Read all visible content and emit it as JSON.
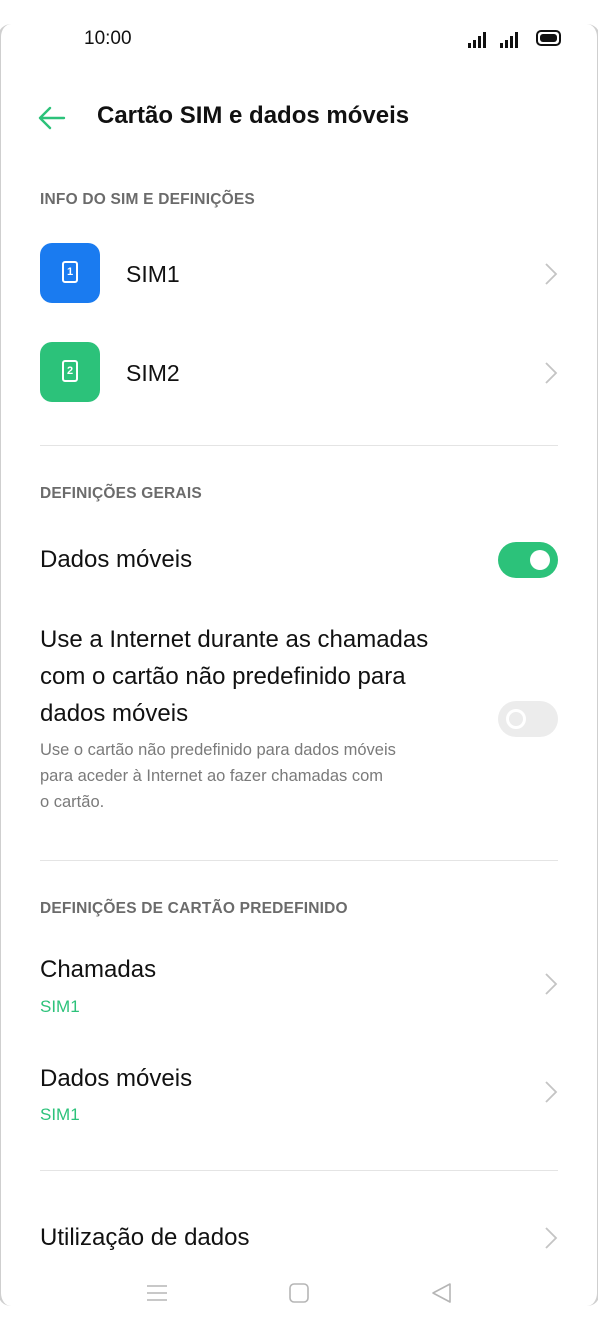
{
  "status_bar": {
    "time": "10:00"
  },
  "app_bar": {
    "title": "Cartão SIM e dados móveis"
  },
  "sim_section": {
    "header": "INFO DO SIM E DEFINIÇÕES",
    "sims": [
      {
        "label": "SIM1",
        "number": "1",
        "color": "#1a7bf0"
      },
      {
        "label": "SIM2",
        "number": "2",
        "color": "#2cc27a"
      }
    ]
  },
  "general_section": {
    "header": "DEFINIÇÕES GERAIS",
    "mobile_data": {
      "label": "Dados móveis",
      "enabled": true
    },
    "internet_during_calls": {
      "label_line1": "Use a Internet durante as chamadas",
      "label_line2": "com o cartão não predefinido para",
      "label_line3": "dados móveis",
      "description_line1": "Use o cartão não predefinido para dados móveis",
      "description_line2": "para aceder à Internet ao fazer chamadas com",
      "description_line3": "o cartão.",
      "enabled": false
    }
  },
  "default_card_section": {
    "header": "DEFINIÇÕES DE CARTÃO PREDEFINIDO",
    "calls": {
      "label": "Chamadas",
      "value": "SIM1"
    },
    "mobile_data": {
      "label": "Dados móveis",
      "value": "SIM1"
    }
  },
  "data_usage": {
    "label": "Utilização de dados"
  },
  "colors": {
    "accent": "#2cc27a",
    "sim1": "#1a7bf0",
    "sim2": "#2cc27a"
  }
}
